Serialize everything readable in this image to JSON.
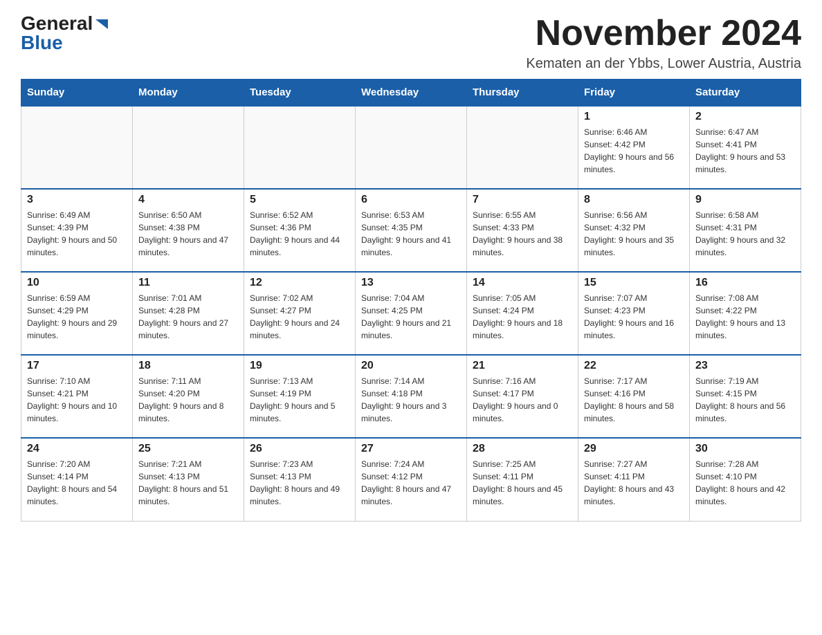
{
  "logo": {
    "general": "General",
    "arrow": "▶",
    "blue": "Blue"
  },
  "title": "November 2024",
  "location": "Kematen an der Ybbs, Lower Austria, Austria",
  "weekdays": [
    "Sunday",
    "Monday",
    "Tuesday",
    "Wednesday",
    "Thursday",
    "Friday",
    "Saturday"
  ],
  "weeks": [
    [
      {
        "day": "",
        "info": ""
      },
      {
        "day": "",
        "info": ""
      },
      {
        "day": "",
        "info": ""
      },
      {
        "day": "",
        "info": ""
      },
      {
        "day": "",
        "info": ""
      },
      {
        "day": "1",
        "info": "Sunrise: 6:46 AM\nSunset: 4:42 PM\nDaylight: 9 hours and 56 minutes."
      },
      {
        "day": "2",
        "info": "Sunrise: 6:47 AM\nSunset: 4:41 PM\nDaylight: 9 hours and 53 minutes."
      }
    ],
    [
      {
        "day": "3",
        "info": "Sunrise: 6:49 AM\nSunset: 4:39 PM\nDaylight: 9 hours and 50 minutes."
      },
      {
        "day": "4",
        "info": "Sunrise: 6:50 AM\nSunset: 4:38 PM\nDaylight: 9 hours and 47 minutes."
      },
      {
        "day": "5",
        "info": "Sunrise: 6:52 AM\nSunset: 4:36 PM\nDaylight: 9 hours and 44 minutes."
      },
      {
        "day": "6",
        "info": "Sunrise: 6:53 AM\nSunset: 4:35 PM\nDaylight: 9 hours and 41 minutes."
      },
      {
        "day": "7",
        "info": "Sunrise: 6:55 AM\nSunset: 4:33 PM\nDaylight: 9 hours and 38 minutes."
      },
      {
        "day": "8",
        "info": "Sunrise: 6:56 AM\nSunset: 4:32 PM\nDaylight: 9 hours and 35 minutes."
      },
      {
        "day": "9",
        "info": "Sunrise: 6:58 AM\nSunset: 4:31 PM\nDaylight: 9 hours and 32 minutes."
      }
    ],
    [
      {
        "day": "10",
        "info": "Sunrise: 6:59 AM\nSunset: 4:29 PM\nDaylight: 9 hours and 29 minutes."
      },
      {
        "day": "11",
        "info": "Sunrise: 7:01 AM\nSunset: 4:28 PM\nDaylight: 9 hours and 27 minutes."
      },
      {
        "day": "12",
        "info": "Sunrise: 7:02 AM\nSunset: 4:27 PM\nDaylight: 9 hours and 24 minutes."
      },
      {
        "day": "13",
        "info": "Sunrise: 7:04 AM\nSunset: 4:25 PM\nDaylight: 9 hours and 21 minutes."
      },
      {
        "day": "14",
        "info": "Sunrise: 7:05 AM\nSunset: 4:24 PM\nDaylight: 9 hours and 18 minutes."
      },
      {
        "day": "15",
        "info": "Sunrise: 7:07 AM\nSunset: 4:23 PM\nDaylight: 9 hours and 16 minutes."
      },
      {
        "day": "16",
        "info": "Sunrise: 7:08 AM\nSunset: 4:22 PM\nDaylight: 9 hours and 13 minutes."
      }
    ],
    [
      {
        "day": "17",
        "info": "Sunrise: 7:10 AM\nSunset: 4:21 PM\nDaylight: 9 hours and 10 minutes."
      },
      {
        "day": "18",
        "info": "Sunrise: 7:11 AM\nSunset: 4:20 PM\nDaylight: 9 hours and 8 minutes."
      },
      {
        "day": "19",
        "info": "Sunrise: 7:13 AM\nSunset: 4:19 PM\nDaylight: 9 hours and 5 minutes."
      },
      {
        "day": "20",
        "info": "Sunrise: 7:14 AM\nSunset: 4:18 PM\nDaylight: 9 hours and 3 minutes."
      },
      {
        "day": "21",
        "info": "Sunrise: 7:16 AM\nSunset: 4:17 PM\nDaylight: 9 hours and 0 minutes."
      },
      {
        "day": "22",
        "info": "Sunrise: 7:17 AM\nSunset: 4:16 PM\nDaylight: 8 hours and 58 minutes."
      },
      {
        "day": "23",
        "info": "Sunrise: 7:19 AM\nSunset: 4:15 PM\nDaylight: 8 hours and 56 minutes."
      }
    ],
    [
      {
        "day": "24",
        "info": "Sunrise: 7:20 AM\nSunset: 4:14 PM\nDaylight: 8 hours and 54 minutes."
      },
      {
        "day": "25",
        "info": "Sunrise: 7:21 AM\nSunset: 4:13 PM\nDaylight: 8 hours and 51 minutes."
      },
      {
        "day": "26",
        "info": "Sunrise: 7:23 AM\nSunset: 4:13 PM\nDaylight: 8 hours and 49 minutes."
      },
      {
        "day": "27",
        "info": "Sunrise: 7:24 AM\nSunset: 4:12 PM\nDaylight: 8 hours and 47 minutes."
      },
      {
        "day": "28",
        "info": "Sunrise: 7:25 AM\nSunset: 4:11 PM\nDaylight: 8 hours and 45 minutes."
      },
      {
        "day": "29",
        "info": "Sunrise: 7:27 AM\nSunset: 4:11 PM\nDaylight: 8 hours and 43 minutes."
      },
      {
        "day": "30",
        "info": "Sunrise: 7:28 AM\nSunset: 4:10 PM\nDaylight: 8 hours and 42 minutes."
      }
    ]
  ]
}
